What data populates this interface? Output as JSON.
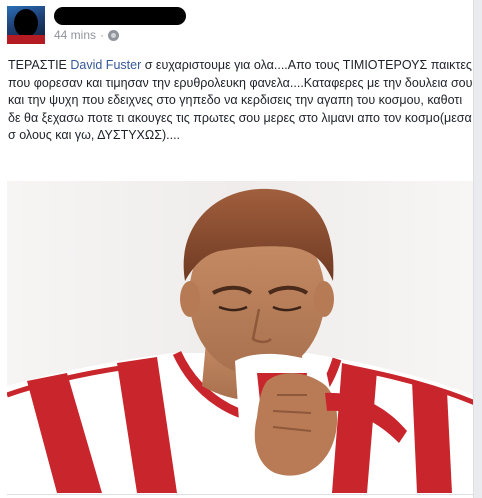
{
  "post": {
    "timestamp": "44 mins",
    "separator": "·",
    "privacy_icon": "globe-icon",
    "menu_icon": "chevron-down-icon",
    "text_prefix": "ΤΕΡΑΣΤΙΕ ",
    "mention": "David Fuster",
    "text_suffix": " σ ευχαριστουμε για ολα....Απο τους ΤΙΜΙΟΤΕΡΟΥΣ παικτες που φορεσαν και τιμησαν την ερυθρολευκη φανελα....Καταφερες με την δουλεια σου και την ψυχη που εδειχνες στο γηπεδο να κερδισεις την αγαπη του κοσμου, καθοτι δε θα ξεχασω ποτε τι ακουγες τις πρωτες σου μερες στο λιμανι απο τον κοσμο(μεσα σ ολους και γω, ΔΥΣΤΥΧΩΣ)...."
  },
  "colors": {
    "link": "#365899",
    "meta": "#90949c",
    "jersey_red": "#c8262c"
  }
}
